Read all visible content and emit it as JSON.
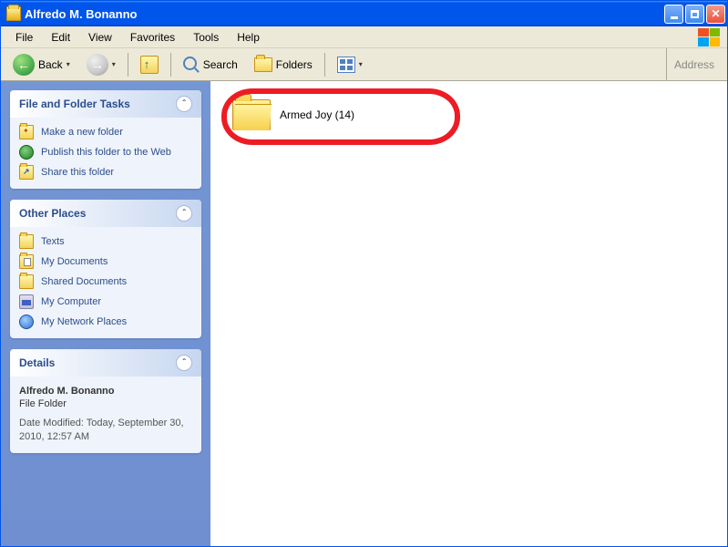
{
  "window": {
    "title": "Alfredo M. Bonanno"
  },
  "menubar": {
    "items": [
      "File",
      "Edit",
      "View",
      "Favorites",
      "Tools",
      "Help"
    ]
  },
  "toolbar": {
    "back": "Back",
    "search": "Search",
    "folders": "Folders",
    "address_label": "Address"
  },
  "sidebar": {
    "tasks": {
      "title": "File and Folder Tasks",
      "items": [
        {
          "icon": "fold star",
          "label": "Make a new folder"
        },
        {
          "icon": "globe",
          "label": "Publish this folder to the Web"
        },
        {
          "icon": "share",
          "label": "Share this folder"
        }
      ]
    },
    "places": {
      "title": "Other Places",
      "items": [
        {
          "icon": "fold",
          "label": "Texts"
        },
        {
          "icon": "docs",
          "label": "My Documents"
        },
        {
          "icon": "fold",
          "label": "Shared Documents"
        },
        {
          "icon": "comp",
          "label": "My Computer"
        },
        {
          "icon": "net",
          "label": "My Network Places"
        }
      ]
    },
    "details": {
      "title": "Details",
      "name": "Alfredo M. Bonanno",
      "type": "File Folder",
      "modified": "Date Modified: Today, September 30, 2010, 12:57 AM"
    }
  },
  "main": {
    "folder_label": "Armed Joy (14)"
  }
}
